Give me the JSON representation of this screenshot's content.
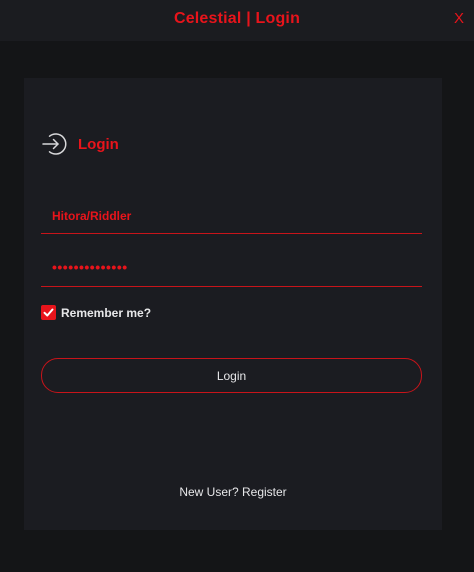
{
  "window": {
    "title": "Celestial | Login",
    "close_label": "X"
  },
  "login": {
    "heading": "Login",
    "icon": "login-arrow-icon",
    "username_value": "Hitora/Riddler",
    "password_masked": "••••••••••••••",
    "remember_label": "Remember me?",
    "remember_checked": true,
    "login_button_label": "Login",
    "register_link": "New User? Register"
  },
  "colors": {
    "accent": "#e8141b",
    "background": "#141517",
    "panel": "#1b1c21",
    "text": "#e7e7e9"
  }
}
